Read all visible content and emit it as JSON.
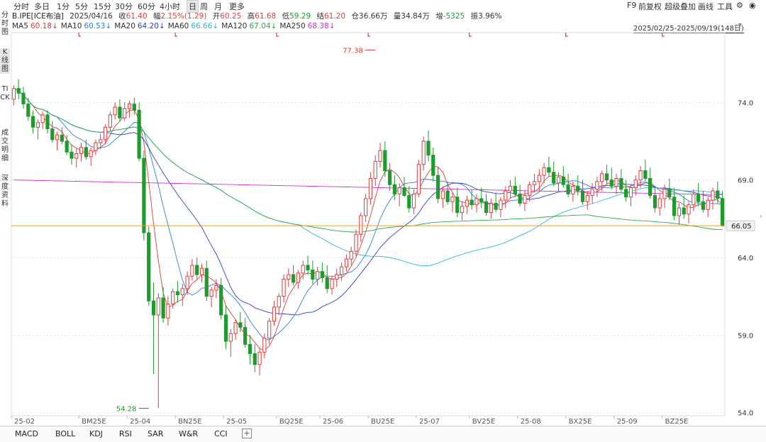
{
  "toolbar": {
    "periods": [
      "分时",
      "多日",
      "1分",
      "5分",
      "15分",
      "30分",
      "60分",
      "4小时",
      "日",
      "周",
      "月",
      "更多"
    ],
    "active_period": "日",
    "right_items": [
      "F9",
      "前复权",
      "超级叠加",
      "画线",
      "工具"
    ],
    "gear_icon": "gear-icon",
    "user_icon": "user-icon"
  },
  "info": {
    "symbol": "B.IPE[ICE布油]",
    "date": "2025/04/16",
    "close_label": "收",
    "close": "61.40",
    "change_label": "幅",
    "change": "2.15%(1.29)",
    "open_label": "开",
    "open": "60.25",
    "high_label": "高",
    "high": "61.68",
    "low_label": "低",
    "low": "59.29",
    "settle_label": "结",
    "settle": "61.20",
    "oi_label": "仓",
    "oi": "36.66万",
    "vol_label": "量",
    "vol": "34.84万",
    "incr_label": "增",
    "incr": "-5325",
    "amp_label": "振",
    "amp": "3.96%"
  },
  "ma": [
    {
      "name": "MA5",
      "value": "60.18↓",
      "color": "#e03c3c"
    },
    {
      "name": "MA10",
      "value": "60.53↓",
      "color": "#2d7fd6"
    },
    {
      "name": "MA20",
      "value": "64.20↓",
      "color": "#2b3fcf"
    },
    {
      "name": "MA60",
      "value": "66.66↓",
      "color": "#29b9d6"
    },
    {
      "name": "MA120",
      "value": "67.04↓",
      "color": "#2fa84a"
    },
    {
      "name": "MA250",
      "value": "68.38↓",
      "color": "#d02fc5"
    }
  ],
  "range_label": "2025/02/25-2025/09/19(148日)",
  "left_nav": [
    "分时图",
    "K线图",
    "TICK",
    "成交明细",
    "深度资料"
  ],
  "left_nav_active": "K线图",
  "bottom_tabs": [
    "MACD",
    "BOLL",
    "KDJ",
    "RSI",
    "SAR",
    "W&R",
    "CCI"
  ],
  "add_label": "+",
  "colors": {
    "up": "#e03c3c",
    "down": "#1f9a2e",
    "grid": "#e2e2e2",
    "price_line": "#e8a23a"
  },
  "chart_data": {
    "type": "candlestick",
    "ylim": [
      53.8,
      78.5
    ],
    "y_ticks": [
      "54.0",
      "59.0",
      "64.0",
      "69.0",
      "74.0"
    ],
    "y_tick_values": [
      54.0,
      59.0,
      64.0,
      69.0,
      74.0
    ],
    "x_labels": [
      {
        "label": "25-02",
        "index": 0
      },
      {
        "label": "BM25E",
        "index": 14
      },
      {
        "label": "25-04",
        "index": 24
      },
      {
        "label": "BN25E",
        "index": 34
      },
      {
        "label": "25-05",
        "index": 44
      },
      {
        "label": "BQ25E",
        "index": 55
      },
      {
        "label": "25-06",
        "index": 64
      },
      {
        "label": "BU25E",
        "index": 74
      },
      {
        "label": "25-07",
        "index": 84
      },
      {
        "label": "BV25E",
        "index": 95
      },
      {
        "label": "25-08",
        "index": 105
      },
      {
        "label": "BX25E",
        "index": 115
      },
      {
        "label": "25-09",
        "index": 125
      },
      {
        "label": "BZ25E",
        "index": 135
      }
    ],
    "current_price": 66.05,
    "current_price_label": "66.05",
    "high_marker": {
      "label": "77.38",
      "value": 77.38,
      "index": 75
    },
    "low_marker": {
      "label": "54.28",
      "value": 54.28,
      "index": 28
    },
    "candles": [
      [
        74.2,
        75.1,
        73.8,
        74.9
      ],
      [
        74.9,
        75.5,
        74.2,
        74.6
      ],
      [
        74.6,
        75.0,
        73.6,
        73.9
      ],
      [
        73.9,
        74.3,
        72.8,
        73.1
      ],
      [
        73.1,
        73.5,
        72.0,
        72.4
      ],
      [
        72.4,
        72.9,
        71.6,
        72.7
      ],
      [
        72.7,
        73.4,
        72.3,
        73.2
      ],
      [
        73.2,
        73.5,
        72.0,
        72.3
      ],
      [
        72.3,
        72.8,
        71.4,
        71.6
      ],
      [
        71.6,
        72.1,
        70.9,
        71.9
      ],
      [
        71.9,
        72.4,
        71.3,
        71.5
      ],
      [
        71.5,
        71.9,
        70.6,
        70.8
      ],
      [
        70.8,
        71.3,
        70.0,
        70.4
      ],
      [
        70.4,
        71.0,
        69.8,
        70.7
      ],
      [
        70.7,
        71.4,
        70.2,
        71.1
      ],
      [
        71.1,
        71.6,
        70.3,
        70.5
      ],
      [
        70.5,
        71.1,
        69.9,
        70.9
      ],
      [
        70.9,
        71.6,
        70.6,
        71.4
      ],
      [
        71.4,
        72.0,
        71.0,
        71.6
      ],
      [
        71.6,
        72.6,
        71.3,
        72.4
      ],
      [
        72.4,
        73.4,
        72.1,
        73.2
      ],
      [
        73.2,
        74.0,
        72.9,
        73.7
      ],
      [
        73.7,
        74.2,
        72.8,
        73.0
      ],
      [
        73.0,
        74.0,
        72.8,
        73.6
      ],
      [
        73.6,
        74.1,
        73.0,
        73.9
      ],
      [
        73.9,
        74.3,
        73.2,
        73.5
      ],
      [
        73.5,
        74.0,
        70.2,
        70.4
      ],
      [
        70.4,
        70.9,
        65.1,
        65.6
      ],
      [
        65.6,
        66.0,
        60.9,
        61.2
      ],
      [
        61.2,
        62.4,
        56.5,
        60.3
      ],
      [
        60.3,
        61.7,
        54.3,
        61.4
      ],
      [
        61.4,
        62.1,
        59.8,
        60.1
      ],
      [
        60.1,
        61.5,
        59.6,
        61.0
      ],
      [
        61.0,
        62.0,
        60.7,
        61.8
      ],
      [
        61.8,
        62.5,
        61.1,
        61.6
      ],
      [
        61.6,
        62.3,
        60.9,
        62.0
      ],
      [
        62.0,
        63.1,
        61.6,
        62.8
      ],
      [
        62.8,
        63.9,
        62.5,
        63.5
      ],
      [
        63.5,
        64.0,
        62.6,
        62.9
      ],
      [
        62.9,
        63.6,
        62.4,
        63.3
      ],
      [
        63.3,
        63.8,
        61.2,
        61.5
      ],
      [
        61.5,
        62.1,
        60.8,
        61.9
      ],
      [
        61.9,
        62.6,
        61.4,
        62.2
      ],
      [
        62.2,
        62.7,
        60.0,
        60.3
      ],
      [
        60.3,
        60.9,
        58.1,
        58.6
      ],
      [
        58.6,
        59.4,
        57.6,
        59.1
      ],
      [
        59.1,
        60.0,
        58.7,
        59.8
      ],
      [
        59.8,
        60.5,
        59.2,
        59.5
      ],
      [
        59.5,
        60.1,
        58.2,
        58.4
      ],
      [
        58.4,
        59.0,
        57.1,
        57.8
      ],
      [
        57.8,
        58.4,
        56.6,
        57.1
      ],
      [
        57.1,
        58.2,
        56.4,
        57.9
      ],
      [
        57.9,
        59.1,
        57.5,
        58.8
      ],
      [
        58.8,
        60.1,
        58.4,
        59.9
      ],
      [
        59.9,
        61.2,
        59.6,
        60.8
      ],
      [
        60.8,
        61.7,
        60.3,
        61.5
      ],
      [
        61.5,
        62.9,
        61.1,
        62.6
      ],
      [
        62.6,
        63.3,
        62.1,
        62.9
      ],
      [
        62.9,
        63.5,
        62.2,
        62.4
      ],
      [
        62.4,
        63.2,
        62.0,
        63.0
      ],
      [
        63.0,
        63.8,
        62.6,
        63.5
      ],
      [
        63.5,
        64.1,
        62.9,
        63.2
      ],
      [
        63.2,
        63.8,
        62.3,
        62.6
      ],
      [
        62.6,
        63.4,
        62.2,
        63.1
      ],
      [
        63.1,
        63.7,
        62.4,
        62.7
      ],
      [
        62.7,
        63.5,
        61.7,
        62.0
      ],
      [
        62.0,
        62.8,
        61.6,
        62.6
      ],
      [
        62.6,
        63.3,
        62.1,
        62.9
      ],
      [
        62.9,
        63.7,
        62.5,
        63.4
      ],
      [
        63.4,
        64.2,
        63.1,
        63.9
      ],
      [
        63.9,
        64.7,
        63.5,
        64.4
      ],
      [
        64.4,
        65.8,
        64.1,
        65.5
      ],
      [
        65.5,
        66.9,
        65.0,
        66.7
      ],
      [
        66.7,
        68.1,
        66.3,
        67.8
      ],
      [
        67.8,
        69.5,
        67.4,
        69.1
      ],
      [
        69.1,
        70.6,
        68.6,
        70.2
      ],
      [
        70.2,
        71.4,
        69.8,
        70.9
      ],
      [
        70.9,
        71.5,
        69.2,
        69.6
      ],
      [
        69.6,
        70.1,
        68.3,
        68.7
      ],
      [
        68.7,
        69.3,
        67.7,
        68.1
      ],
      [
        68.1,
        68.8,
        67.3,
        68.5
      ],
      [
        68.5,
        69.2,
        67.9,
        68.0
      ],
      [
        68.0,
        68.6,
        66.9,
        67.2
      ],
      [
        67.2,
        68.4,
        66.8,
        68.1
      ],
      [
        68.1,
        70.3,
        67.9,
        70.0
      ],
      [
        70.0,
        71.8,
        69.6,
        71.5
      ],
      [
        71.5,
        72.2,
        70.2,
        70.6
      ],
      [
        70.6,
        71.1,
        68.9,
        69.3
      ],
      [
        69.3,
        69.8,
        67.5,
        67.8
      ],
      [
        67.8,
        68.6,
        67.2,
        68.3
      ],
      [
        68.3,
        68.9,
        67.4,
        67.6
      ],
      [
        67.6,
        68.2,
        66.9,
        67.9
      ],
      [
        67.9,
        68.5,
        66.6,
        66.9
      ],
      [
        66.9,
        67.6,
        66.4,
        67.3
      ],
      [
        67.3,
        68.0,
        66.8,
        67.7
      ],
      [
        67.7,
        68.4,
        67.1,
        67.4
      ],
      [
        67.4,
        68.1,
        66.9,
        67.8
      ],
      [
        67.8,
        68.5,
        67.2,
        67.6
      ],
      [
        67.6,
        68.1,
        66.7,
        66.9
      ],
      [
        66.9,
        67.8,
        66.5,
        67.5
      ],
      [
        67.5,
        68.2,
        66.9,
        67.1
      ],
      [
        67.1,
        67.9,
        66.6,
        67.7
      ],
      [
        67.7,
        68.6,
        67.2,
        68.3
      ],
      [
        68.3,
        69.0,
        67.8,
        68.6
      ],
      [
        68.6,
        69.2,
        67.9,
        68.1
      ],
      [
        68.1,
        68.7,
        67.3,
        67.5
      ],
      [
        67.5,
        68.3,
        67.0,
        68.0
      ],
      [
        68.0,
        68.9,
        67.6,
        68.7
      ],
      [
        68.7,
        69.4,
        68.2,
        68.9
      ],
      [
        68.9,
        69.7,
        68.3,
        69.3
      ],
      [
        69.3,
        70.1,
        68.8,
        69.8
      ],
      [
        69.8,
        70.5,
        69.2,
        69.5
      ],
      [
        69.5,
        70.2,
        68.6,
        68.8
      ],
      [
        68.8,
        69.5,
        68.2,
        69.2
      ],
      [
        69.2,
        69.9,
        68.5,
        68.7
      ],
      [
        68.7,
        69.4,
        67.9,
        68.1
      ],
      [
        68.1,
        68.9,
        67.6,
        68.6
      ],
      [
        68.6,
        69.3,
        68.0,
        68.3
      ],
      [
        68.3,
        69.0,
        67.4,
        67.6
      ],
      [
        67.6,
        68.3,
        67.1,
        68.0
      ],
      [
        68.0,
        68.8,
        67.5,
        68.4
      ],
      [
        68.4,
        69.2,
        67.9,
        68.9
      ],
      [
        68.9,
        69.6,
        68.3,
        69.4
      ],
      [
        69.4,
        70.0,
        68.7,
        69.0
      ],
      [
        69.0,
        69.8,
        68.4,
        68.6
      ],
      [
        68.6,
        69.4,
        68.1,
        69.1
      ],
      [
        69.1,
        69.7,
        68.2,
        68.4
      ],
      [
        68.4,
        69.0,
        67.6,
        67.9
      ],
      [
        67.9,
        68.7,
        67.3,
        68.5
      ],
      [
        68.5,
        69.3,
        68.0,
        69.0
      ],
      [
        69.0,
        69.9,
        68.5,
        69.6
      ],
      [
        69.6,
        70.3,
        68.9,
        69.1
      ],
      [
        69.1,
        69.8,
        67.8,
        68.0
      ],
      [
        68.0,
        68.6,
        66.9,
        67.2
      ],
      [
        67.2,
        68.1,
        66.7,
        67.8
      ],
      [
        67.8,
        68.7,
        67.2,
        68.4
      ],
      [
        68.4,
        69.1,
        67.7,
        67.9
      ],
      [
        67.9,
        68.5,
        66.4,
        66.7
      ],
      [
        66.7,
        67.5,
        66.1,
        67.2
      ],
      [
        67.2,
        68.0,
        66.5,
        66.8
      ],
      [
        66.8,
        67.6,
        66.2,
        67.4
      ],
      [
        67.4,
        68.4,
        67.0,
        68.1
      ],
      [
        68.1,
        68.8,
        67.3,
        67.6
      ],
      [
        67.6,
        68.3,
        66.9,
        67.1
      ],
      [
        67.1,
        67.9,
        66.6,
        67.7
      ],
      [
        67.7,
        68.5,
        67.1,
        68.3
      ],
      [
        68.3,
        68.9,
        67.5,
        67.8
      ],
      [
        67.8,
        68.3,
        66.0,
        66.05
      ]
    ]
  }
}
